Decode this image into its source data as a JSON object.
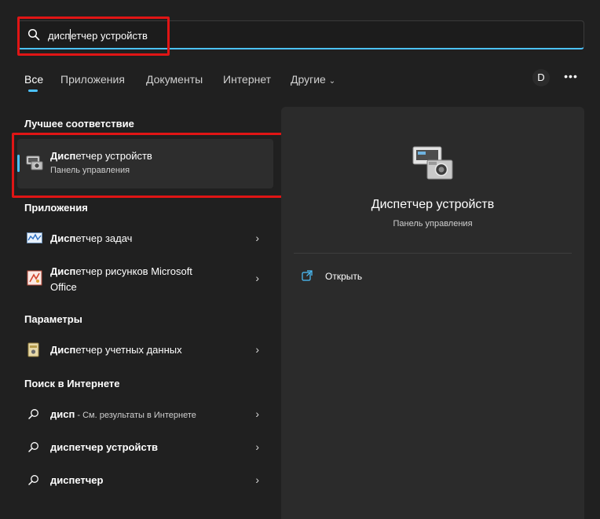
{
  "search": {
    "query_bold": "дисп",
    "query_rest": "етчер устройств"
  },
  "tabs": [
    "Все",
    "Приложения",
    "Документы",
    "Интернет",
    "Другие"
  ],
  "user_initial": "D",
  "more_label": "•••",
  "best_match": {
    "heading": "Лучшее соответствие",
    "title_bold": "Дисп",
    "title_rest": "етчер устройств",
    "subtitle": "Панель управления"
  },
  "apps": {
    "heading": "Приложения",
    "items": [
      {
        "bold": "Дисп",
        "rest": "етчер задач"
      },
      {
        "bold": "Дисп",
        "rest": "етчер рисунков Microsoft",
        "rest2": "Office"
      }
    ]
  },
  "settings": {
    "heading": "Параметры",
    "items": [
      {
        "bold": "Дисп",
        "rest": "етчер учетных данных"
      }
    ]
  },
  "web": {
    "heading": "Поиск в Интернете",
    "items": [
      {
        "bold": "дисп",
        "rest": " - См. результаты в Интернете"
      },
      {
        "bold": "диспетчер устройств",
        "rest": ""
      },
      {
        "bold": "диспетчер",
        "rest": ""
      }
    ]
  },
  "preview": {
    "title": "Диспетчер устройств",
    "subtitle": "Панель управления",
    "open_label": "Открыть"
  },
  "colors": {
    "accent": "#4cc2ff",
    "highlight_box": "#e01515",
    "background": "#202020",
    "panel": "#2b2b2b"
  }
}
